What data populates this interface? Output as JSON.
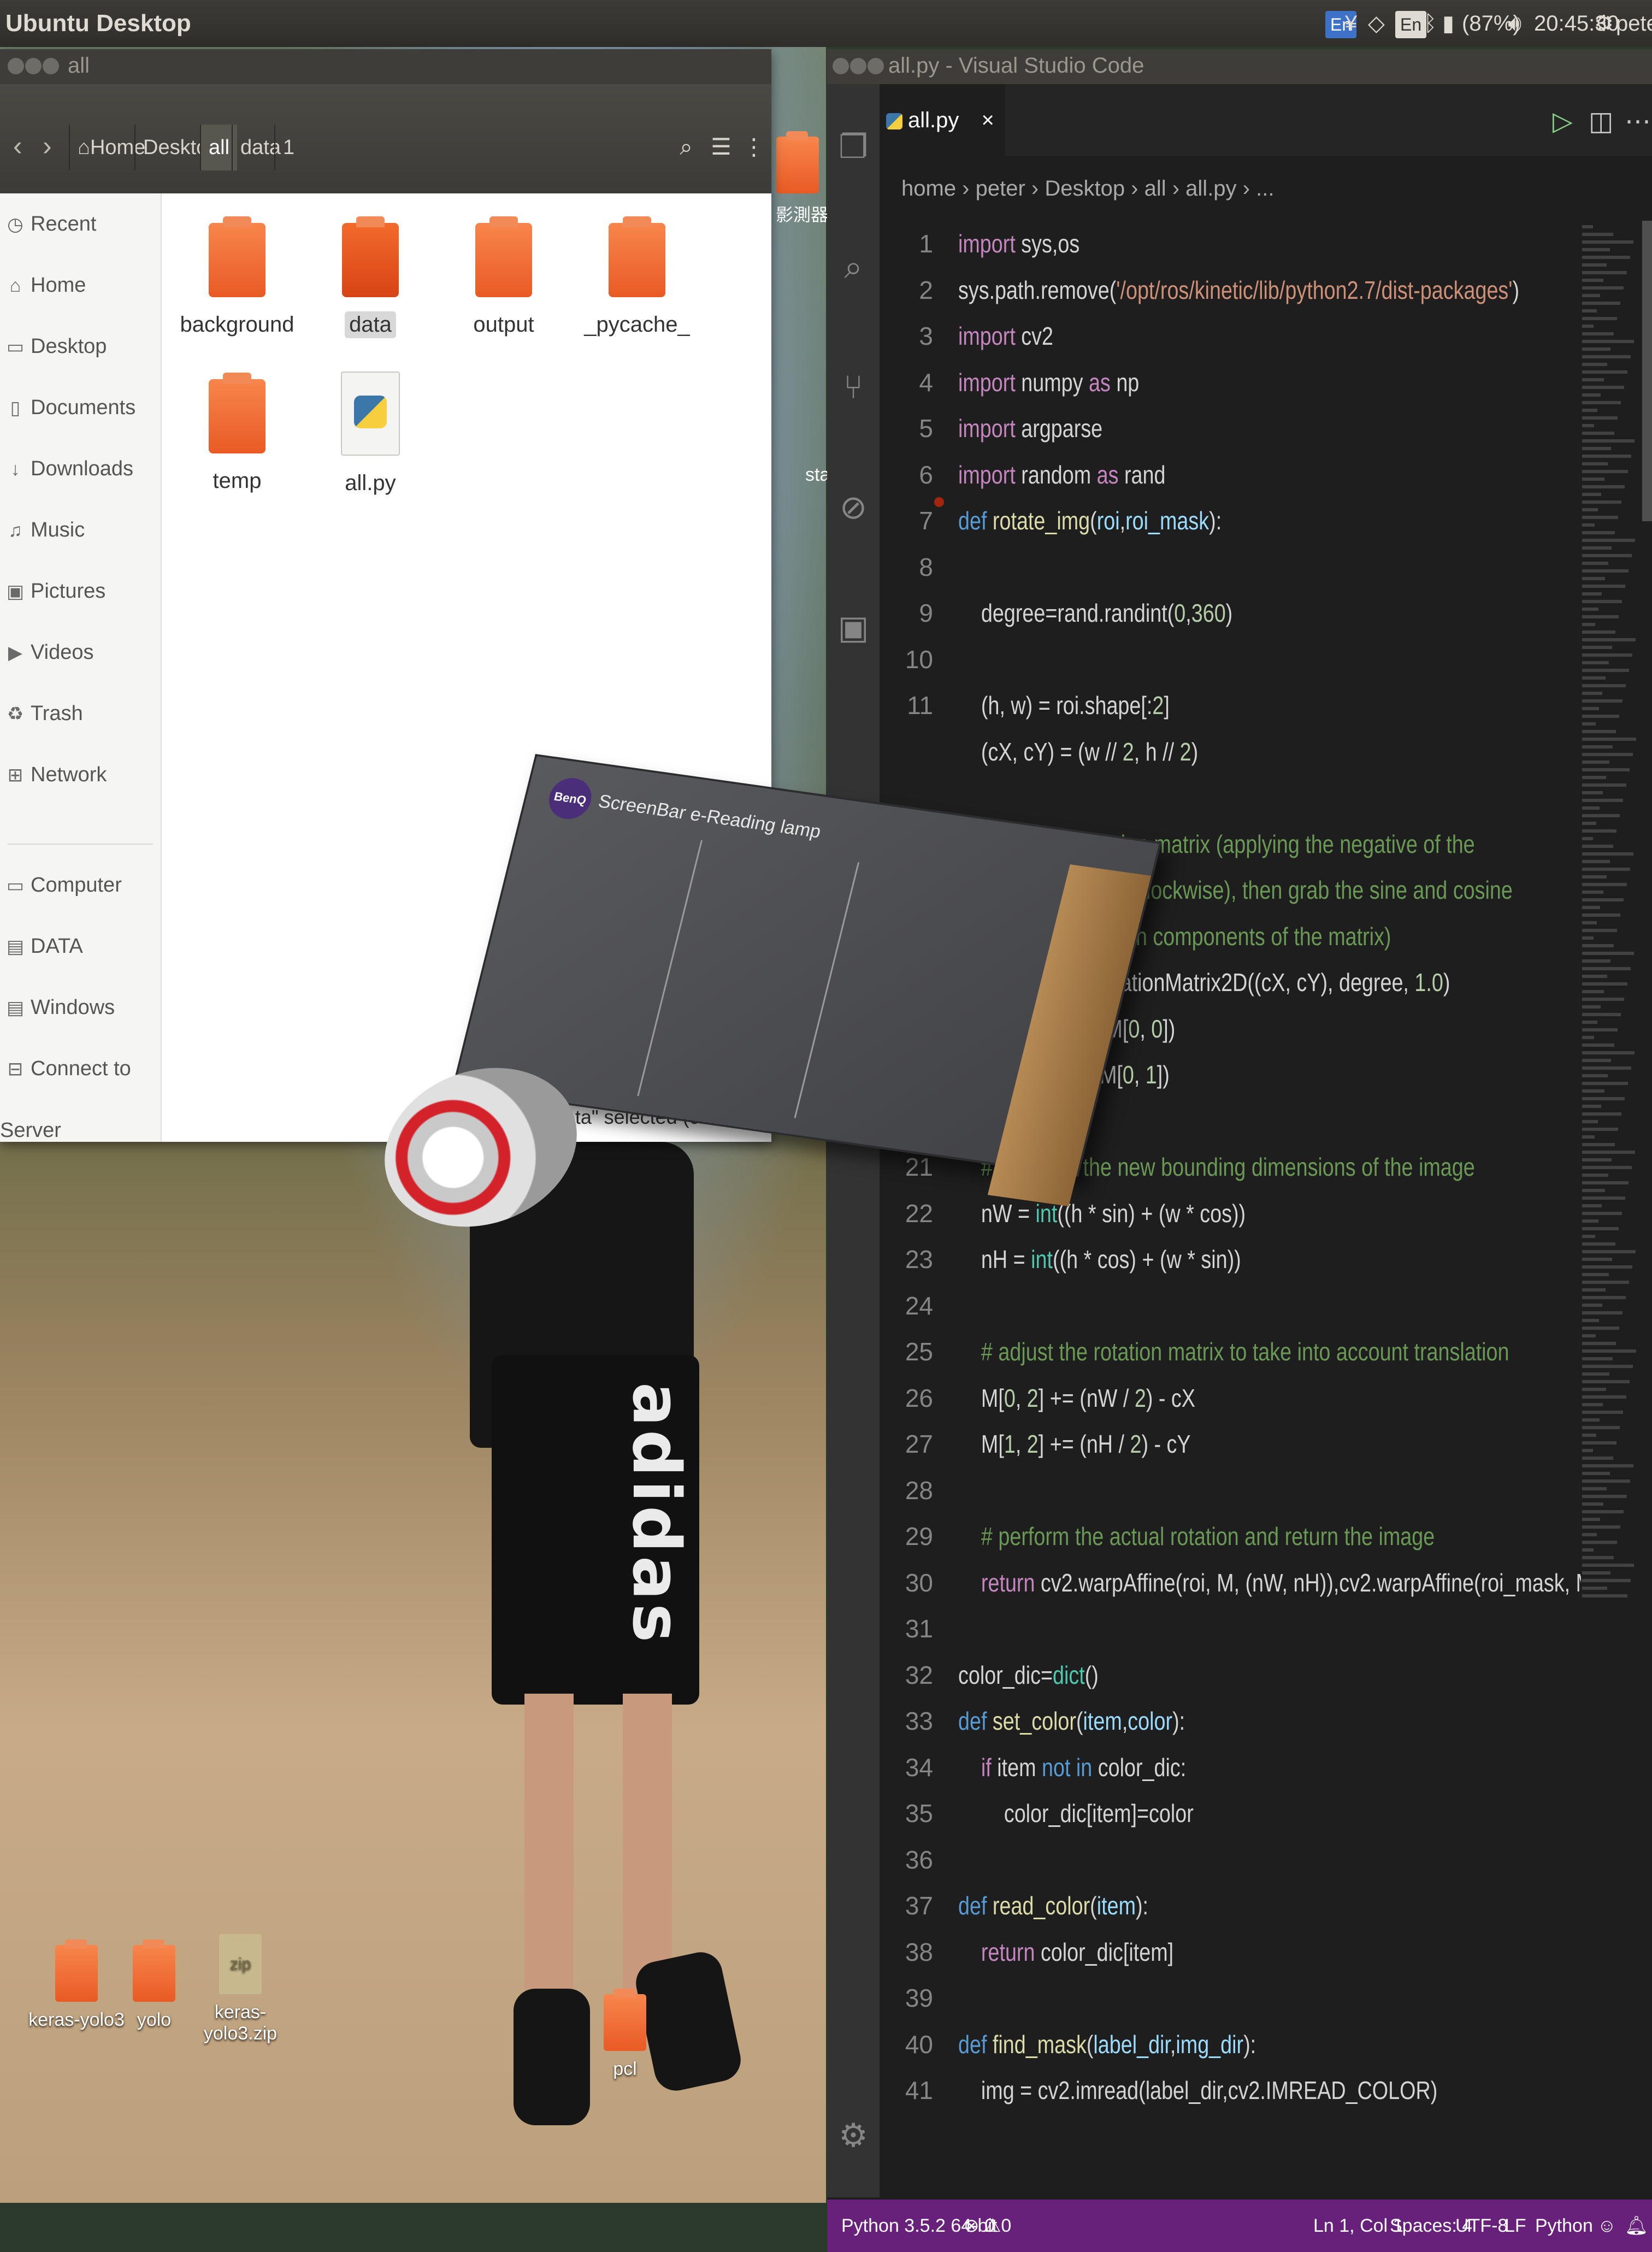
{
  "top_panel": {
    "title": "Ubuntu Desktop",
    "indicator_en1": "En",
    "indicator_ime": "¥",
    "indicator_en2": "En",
    "battery": "(87%)",
    "time": "20:45:30",
    "user": "peter"
  },
  "file_manager": {
    "window_title": "all",
    "breadcrumbs": [
      "Home",
      "Desktop",
      "all",
      "data",
      "1"
    ],
    "sidebar": [
      {
        "icon": "clock-icon",
        "label": "Recent"
      },
      {
        "icon": "home-icon",
        "label": "Home"
      },
      {
        "icon": "desktop-icon",
        "label": "Desktop"
      },
      {
        "icon": "document-icon",
        "label": "Documents"
      },
      {
        "icon": "download-icon",
        "label": "Downloads"
      },
      {
        "icon": "music-icon",
        "label": "Music"
      },
      {
        "icon": "picture-icon",
        "label": "Pictures"
      },
      {
        "icon": "video-icon",
        "label": "Videos"
      },
      {
        "icon": "trash-icon",
        "label": "Trash"
      },
      {
        "icon": "network-icon",
        "label": "Network"
      },
      {
        "icon": "computer-icon",
        "label": "Computer"
      },
      {
        "icon": "drive-icon",
        "label": "DATA"
      },
      {
        "icon": "drive-icon",
        "label": "Windows"
      },
      {
        "icon": "server-icon",
        "label": "Connect to Server"
      }
    ],
    "files": [
      {
        "name": "background",
        "type": "folder"
      },
      {
        "name": "data",
        "type": "folder"
      },
      {
        "name": "output",
        "type": "folder"
      },
      {
        "name": "_pycache_",
        "type": "folder"
      },
      {
        "name": "temp",
        "type": "folder"
      },
      {
        "name": "all.py",
        "type": "python"
      }
    ],
    "status": "\"data\" selected (containing"
  },
  "desktop_icons": [
    {
      "label": "keras-yolo3",
      "type": "folder"
    },
    {
      "label": "yolo",
      "type": "folder"
    },
    {
      "label": "keras-yolo3.zip",
      "type": "zip",
      "badge": "zip"
    },
    {
      "label": "pcl",
      "type": "folder"
    }
  ],
  "desktop_partial_text": [
    "影測器回",
    "sta"
  ],
  "vscode": {
    "window_title": "all.py - Visual Studio Code",
    "tab": "all.py",
    "tab_close": "×",
    "breadcrumbs": "home › peter › Desktop › all › all.py › ...",
    "line_numbers": [
      "1",
      "2",
      "3",
      "4",
      "5",
      "6",
      "7",
      "8",
      "9",
      "10",
      "11",
      "",
      "",
      "",
      "",
      "",
      "",
      "",
      "",
      "",
      "21",
      "22",
      "23",
      "24",
      "25",
      "26",
      "27",
      "28",
      "29",
      "30",
      "31",
      "32",
      "33",
      "34",
      "35",
      "36",
      "37",
      "38",
      "39",
      "40",
      "41"
    ],
    "status": {
      "python": "Python 3.5.2 64-bit",
      "errors": "0",
      "warnings": "0",
      "position": "Ln 1, Col 1",
      "spaces": "Spaces: 4",
      "encoding": "UTF-8",
      "eol": "LF",
      "language": "Python"
    }
  },
  "box": {
    "brand": "BenQ",
    "title": "ScreenBar e-Reading lamp"
  },
  "shorts_text": "adidas",
  "colors": {
    "vscode_statusbar": "#68217a",
    "folder_orange": "#e95a24",
    "editor_bg": "#1e1e1e"
  }
}
